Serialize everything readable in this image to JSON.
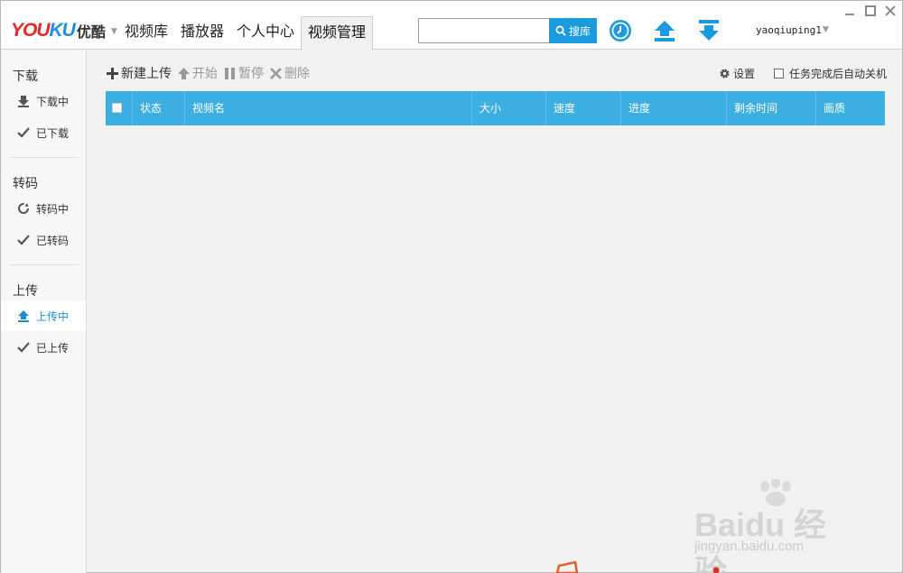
{
  "app": {
    "logo_text_red": "YOU",
    "logo_text_blue": "KU",
    "logo_cn": "优酷",
    "accent_color": "#3daee2",
    "brand_red": "#e8262a"
  },
  "nav": {
    "tabs": [
      {
        "label": "视频库"
      },
      {
        "label": "播放器"
      },
      {
        "label": "个人中心"
      },
      {
        "label": "视频管理"
      }
    ],
    "active_tab": "视频管理"
  },
  "search": {
    "value": "",
    "placeholder": "",
    "button_label": "搜库"
  },
  "header_icons": [
    "clock-icon",
    "upload-arrow-icon",
    "download-arrow-icon"
  ],
  "user": {
    "name": "yaoqiuping1"
  },
  "window_controls": [
    "minimize-icon",
    "maximize-icon",
    "close-icon"
  ],
  "sidebar": {
    "sections": [
      {
        "title": "下载",
        "items": [
          {
            "label": "下载中",
            "icon": "download-icon"
          },
          {
            "label": "已下载",
            "icon": "check-icon"
          }
        ]
      },
      {
        "title": "转码",
        "items": [
          {
            "label": "转码中",
            "icon": "refresh-icon"
          },
          {
            "label": "已转码",
            "icon": "check-icon"
          }
        ]
      },
      {
        "title": "上传",
        "items": [
          {
            "label": "上传中",
            "icon": "upload-icon",
            "active": true
          },
          {
            "label": "已上传",
            "icon": "check-icon"
          }
        ]
      }
    ]
  },
  "toolbar": {
    "new_upload": "新建上传",
    "start": "开始",
    "pause": "暂停",
    "delete": "删除",
    "settings": "设置",
    "auto_shutdown": "任务完成后自动关机"
  },
  "table": {
    "columns": [
      "状态",
      "视频名",
      "大小",
      "速度",
      "进度",
      "剩余时间",
      "画质"
    ],
    "rows": []
  },
  "watermark": {
    "text": "Bai",
    "text2": "du",
    "text_cn": "经验",
    "url": "jingyan.baidu.com"
  }
}
